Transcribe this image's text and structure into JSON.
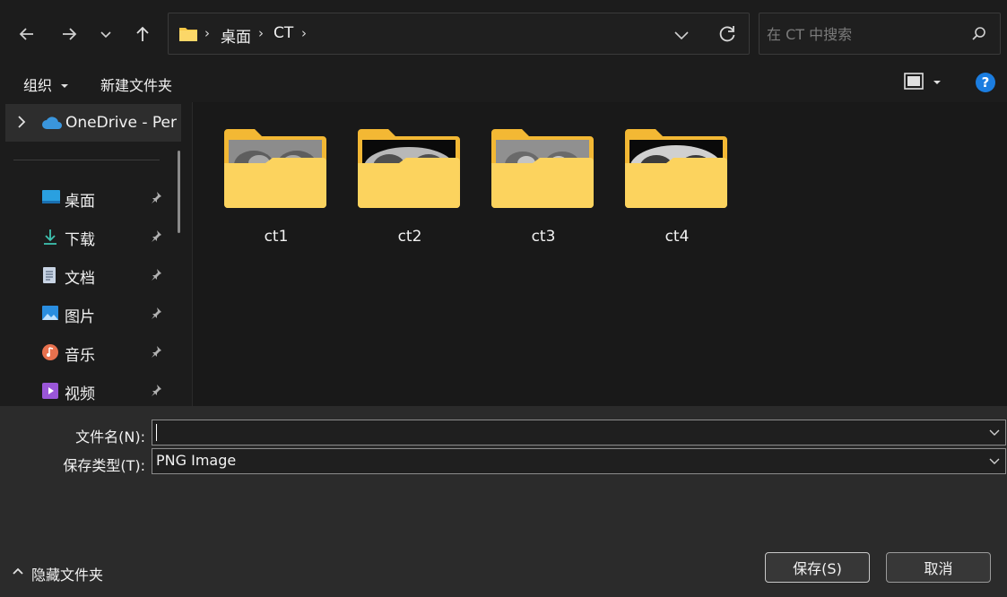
{
  "nav": {
    "path": [
      "桌面",
      "CT"
    ]
  },
  "search": {
    "placeholder": "在 CT 中搜索"
  },
  "toolbar": {
    "organize_label": "组织",
    "new_folder_label": "新建文件夹",
    "help_label": "?"
  },
  "sidebar": {
    "onedrive_label": "OneDrive - Per",
    "items": [
      {
        "label": "桌面",
        "icon": "desktop-icon"
      },
      {
        "label": "下载",
        "icon": "download-icon"
      },
      {
        "label": "文档",
        "icon": "document-icon"
      },
      {
        "label": "图片",
        "icon": "pictures-icon"
      },
      {
        "label": "音乐",
        "icon": "music-icon"
      },
      {
        "label": "视频",
        "icon": "video-icon"
      }
    ]
  },
  "folders": [
    {
      "name": "ct1"
    },
    {
      "name": "ct2"
    },
    {
      "name": "ct3"
    },
    {
      "name": "ct4"
    }
  ],
  "form": {
    "filename_label": "文件名(N):",
    "filename_value": "",
    "filetype_label": "保存类型(T):",
    "filetype_value": "PNG Image"
  },
  "footer": {
    "hide_folders_label": "隐藏文件夹",
    "save_label": "保存(S)",
    "cancel_label": "取消"
  },
  "colors": {
    "folder_yellow": "#f8c846",
    "accent_blue": "#1b7de0"
  }
}
